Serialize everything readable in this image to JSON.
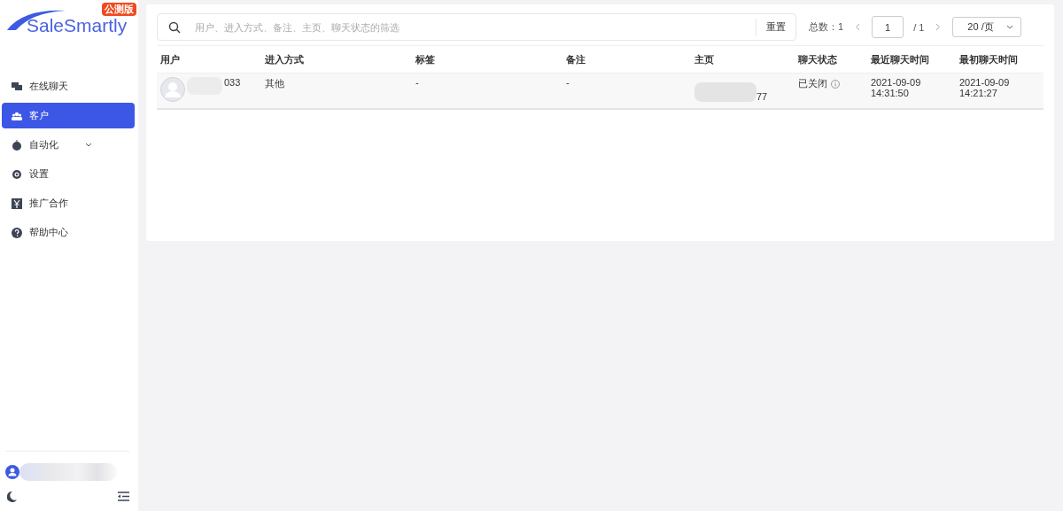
{
  "brand": {
    "logo": "SaleSmartly",
    "badge": "公测版"
  },
  "nav": [
    {
      "label": "在线聊天",
      "selected": false,
      "has_submenu": false
    },
    {
      "label": "客户",
      "selected": true,
      "has_submenu": false
    },
    {
      "label": "自动化",
      "selected": false,
      "has_submenu": true
    },
    {
      "label": "设置",
      "selected": false,
      "has_submenu": false
    },
    {
      "label": "推广合作",
      "selected": false,
      "has_submenu": false
    },
    {
      "label": "帮助中心",
      "selected": false,
      "has_submenu": false
    }
  ],
  "search": {
    "placeholder": "用户、进入方式、备注、主页、聊天状态的筛选",
    "reset": "重置"
  },
  "pagination": {
    "total": "总数：1",
    "page": "1",
    "pages": "/ 1",
    "page_size": "20 /页"
  },
  "table": {
    "columns": [
      "用户",
      "进入方式",
      "标签",
      "备注",
      "主页",
      "聊天状态",
      "最近聊天时间",
      "最初聊天时间"
    ],
    "rows": [
      {
        "user": "033",
        "entry": "其他",
        "tags": "-",
        "note": "-",
        "homepage": "77",
        "status": "已关闭",
        "last_chat": [
          "2021-09-09",
          "14:31:50"
        ],
        "first_chat": [
          "2021-09-09",
          "14:21:27"
        ]
      }
    ]
  }
}
